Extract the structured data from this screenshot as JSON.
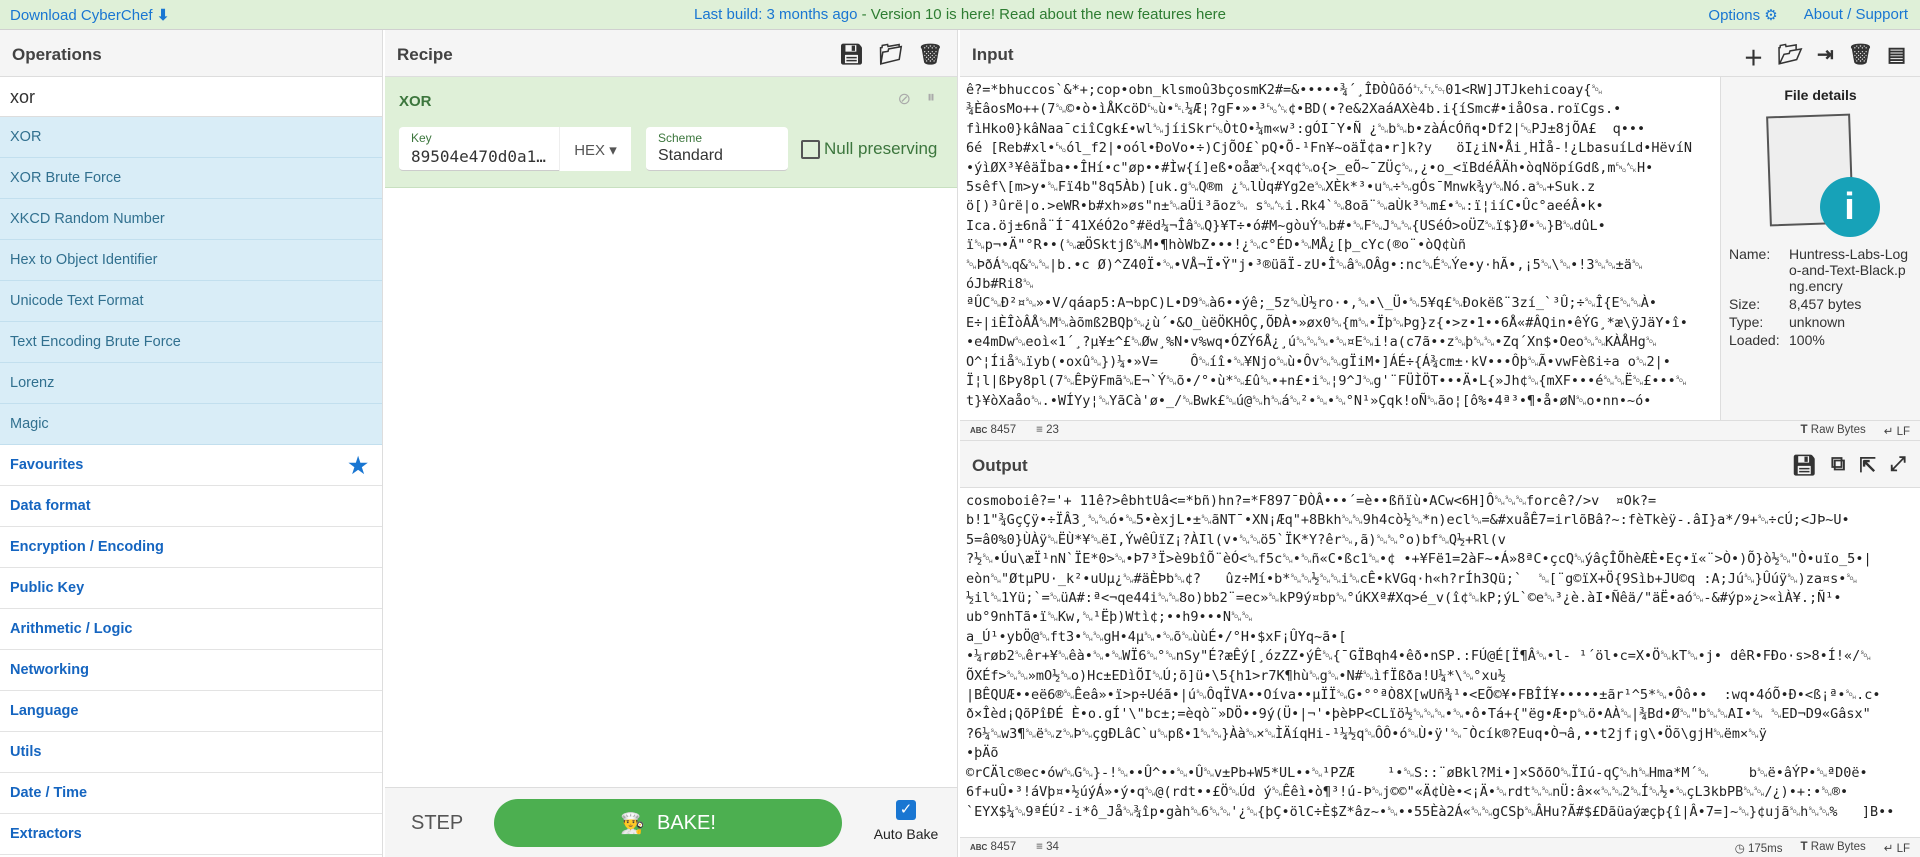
{
  "topbar": {
    "download": "Download CyberChef",
    "build_notice": "Last build: 3 months ago",
    "version_notice": " - Version 10 is here! Read about the new features here",
    "options": "Options",
    "about": "About / Support"
  },
  "operations": {
    "title": "Operations",
    "search": "xor",
    "results": [
      "XOR",
      "XOR Brute Force",
      "XKCD Random Number",
      "Hex to Object Identifier",
      "Unicode Text Format",
      "Text Encoding Brute Force",
      "Lorenz",
      "Magic"
    ],
    "categories": [
      "Favourites",
      "Data format",
      "Encryption / Encoding",
      "Public Key",
      "Arithmetic / Logic",
      "Networking",
      "Language",
      "Utils",
      "Date / Time",
      "Extractors"
    ]
  },
  "recipe": {
    "title": "Recipe",
    "op_name": "XOR",
    "key_label": "Key",
    "key_value": "89504e470d0a1…",
    "key_format": "HEX",
    "scheme_label": "Scheme",
    "scheme_value": "Standard",
    "null_preserving": "Null preserving",
    "step": "STEP",
    "bake": "BAKE!",
    "auto_bake": "Auto Bake",
    "auto_bake_checked": true
  },
  "input": {
    "title": "Input",
    "lines": [
      "ê?=*bhuccos`&*+;cop•obn_klsmoû3bçosmK2#=&•••••¾´¸ÎÐÒûõó␂␃␄01<RW]JTJkehicoay{␁",
      "¾ÈâosMo++(7␁©•ò•ìÅKcöD␅ù•␇¼Æ¦?gF•»•³␅␆¢•BD(•?e&2XaáAXè4b.i{íSmc#•iåOsa.roïCgs.•",
      "fìHko0}kâNaa¯ciîCgk£•wl␁jíiSkr␅ÒtO•¼m«w³:gÓI¯Y•Ñ ¿␁b␁b•zàÁcÓñq•Df2|␅PJ±8jÕA£  q•••",
      "6é [Reb#xl•␅ól_f2|•oól•ÐoVo•÷)CjÕO£`pQ•Õ-¹Fn¥~oäÏ¢a•r]k?y   öI¿iN•Åi¸HÌå-!¿LbasuíLd•HëvíN",
      "•ýìØX³¥êäÏba••ÎHí•c\"øp••#Ìw{í]eß•oåæ␁{×q¢␁o{>_eÕ~¯ZÜç␁,¿•o_<ïBdéÂÄh•òqNöpíGdß,m␅␆H•",
      "5sêf\\[m>y•␁Fï4b\"8q5Àb)[uk.g␁Q®m ¿␁lÙq#Yg2e␁XÈk*³•u␁÷␁gÓs¯Mnwk¾y␁Nó.a␁+Suk.z",
      "ö[)³ûrë|o.>eWR•b#xh»øs\"n±␁aÜi³ãoz␁ s␁␆i.Rk4`␁8oã¨␁aÙk³␁m£•␁:ï¦iíC•Ûc°aeéÂ•k•",
      "Ica.öj±6nå¨Í¯41XéÓ2o°#ëd¼¬Îâ␁Q}¥T÷•ó#M~gòuÝ␁b#•␁F␁J␁␁{USéÓ>oÜZ␁ï$}Ø•␁}B␁dûL•",
      "ï␁p¬•Ä\"°R••(␁æÖSktjß␁M•¶hòWbZ•••!¿␁c°ÉD•␁MÅ¿[þ_cYc(®o¨•òQ¢ùñ",
      "␁ÞðÁ␁q&␁␁|b.•c Ø)^Z40Ï•␁•VÅ¬Ï•Ÿ\"j•³®üãÏ-zU•Î␁â␁OÂg•:nc␁É␁Ýe•y·hÃ•,¡5␁\\␁•!3␁␁±ä␁",
      "óJb#Ri8␁",
      "ªÛC␁Ð²¤␁»•V/qáap5:A¬bpC)L•D9␁à6••ýê;_5z␁Ù½ro·•,␁•\\_Ü•␁5¥q£␁Ðokëß¨3zí_`³Û;÷␁Î{E␁␁À•",
      "E÷|iÈÎòÂÅ␁M␁àõmß2BQþ␁¿ù´•&O_ùëÖKHÔÇ,ÕÐÀ•»øx0␁{m␁•Ïþ␁Þg}z{•>z•1••6Å«#ÂQin•êÝG¸*æ\\ÿJäY•î•",
      "•e4mDw␁eoì«1´¸?µ¥±^£␁Øw¸%N•v%wq•ÓZÝ6Å¿¸ú␁␁␁•␁¤E␁i!a(c7ã••z␁þ␁␁•Zq´Xn$•Oeo␁␁KÀÅHg␁",
      "O^¦Íiå␁ïyb(•oxû␁})¼•»V=    Ô␁íî•␁¥Njo␁ù•Ôv␁␁gÏiM•]ÁÉ÷{Á¾cm±·kV•••Ôþ␁Ã•vwFèßi÷a o␁2|•",
      "Ï¦l|ßÞy8pl(7␁ÊÞÿFmã␁E¬`Ý␁õ•/°•ù*␁£û␁•+n£•i␁¦9^J␁g'¨FÜÌÖT•••Ä•L{»Jh¢␁{mXF•••é␁␁Ë␁£•••␁",
      "t}¥òXaåo␁.•WÍYy¦␁YãCà'ø•_/␁Bwk£␁ú@␁h␁á␁²•␁•␁°N¹»Çqk!oÑ␁ão¦[ô%•4ª³•¶•å•øN␁o•nn•~ó•"
    ],
    "length": "8457",
    "line_count": "23",
    "format": "Raw Bytes",
    "eol": "LF",
    "file": {
      "title": "File details",
      "name_label": "Name:",
      "name": "Huntress-Labs-Logo-and-Text-Black.png.encry",
      "size_label": "Size:",
      "size": "8,457 bytes",
      "type_label": "Type:",
      "type": "unknown",
      "loaded_label": "Loaded:",
      "loaded": "100%"
    }
  },
  "output": {
    "title": "Output",
    "lines": [
      "cosmoboiê?='+ 11ê?>êbhtUâ<=*bñ)hn?=*F897¯ÐÒÂ•••´=è••ßñïù•ACw<6H]Ô␁␁␁forcê?/>v  ¤Ok?=",
      "b!1\"¾GçÇÿ•÷ÏÂ3¸␁␁ó•␁5•èxjL•±␁ãNT¯•XN¡Æq\"+8Bkh␁␁9h4cò½␁*n)ecl␁=&#xuåÊ7=irlõBâ?~:fèTkèÿ-.âI}a*/9+␁÷cÚ;<JÞ~U•",
      "5=â0%0}ÙÀÿ␁ËÙ*¥␁ëI,ÝwêÛïZ¡?ÀIl(v•␁␁ö5`ÏK*Y?êr␁,ã)␁␁°o)bf␁Q½+Rl(v",
      "?½␁•Úu\\æÏ¹nN`ÏE*0>␁•Þ7³Ï>è9bîÕ¨èÓ<␁f5c␁•␁ñ«C•ßc1␁•¢ •+¥Fë1=2àF~•Á»8ªC•çcQ␁ýâçÎÕhèÆÈ•Eç•ï«¨>Ò•)Õ}ò½␁\"Ò•uïo_5•|",
      "eòn␁\"ØtµPU·_k²•uUµ¿␁#äÈÞb␁¢?   ûz÷Mí•b*␁␁½␁␁i␁cÊ•kVGq·h«h?rÍh3Qü;`  ␁[¨g©ïX+Ö{9Sìb+JU©q :A;Jú␁}Ûúÿ␁)za¤s•␁",
      "½il␁1Yü;`=␁üA#:ª<¬qe44i␁␁8o)bb2¨=ec»␁kP9ý¤bp␁°úKXª#Xq>é_v(î¢␁kP;ýL`©e␁³¿è.àI•Ñêä/\"äË•aó␁-&#ýp»¿>«ìÀ¥.;Ñ¹•",
      "ub°9nhTã•ï␁Kw,␁¹Ëþ)Wtì¢;••h9•••N␁␁",
      "a_Ú¹•ybÖ@␁ft3•␁␁gH•4µ␁•␁õ␁ùùÉ•/°H•$xF¡ÛYq~ã•[",
      "•¼røb2␁êr+¥␁êà•␁•␁WÏ6␁°␁nSy\"É?æÊý[¸ózZZ•ýÊ␁{¯GÏBqh4•êð•nSP.:FÚ@É[Ï¶Â␁•l- ¹´öl•c=X•Ö␁kT␁•j• dêR•FÐo·s>8•Í!«/␁",
      "ÕXÉf>␁␁»mO½␁o)Hc±EDìÕI␁Ú;õ]ü•\\5{h1>r7K¶hù␁g␁•N#␁ìfÏßða!U¼*\\␁°xu½",
      "|BÊQUÆ••eë6®␁Êeâ»•ï>p÷Uéã•|ú␁ÔqÏVA••Oíva••µÏÏ␁G•°°ªÒ8X[wUñ¾¹•<EÕ©¥•FBÎÍ¥•••••±ãr¹^5*␁•Ôô••  :wq•4óÕ•Ð•<ß¡ª•␁.c•",
      "ð×Îèd¡QõPîÐÉ È•o.gÍ'\\\"bc±;=èqò¨»DÖ••9ý(Ü•|¬'•þèÞP<CLïö½␁␁␁•␁•ô•Tá+{\"ëg•Æ•p␁ö•AÀ␁|¾Bd•Ø␁\"b␁␁AI•␁ ␁ED¬D9«Gâsx\"",
      "?6¼␁w3¶␁ë␁z␁Þ␁çgÐLâC`u␁pß•1␁␁}Àà␁×␁ÌÄíqHi-¹¼½q␁ÔÔ•ó␁Ù•ÿ'␁¯Òcík®?Euq•Ò¬â,••t2jf¡g\\•Öõ\\gjH␁ëm×␁ÿ",
      "•þÄõ",
      "©rCÄlc®ec•ów␁G␁}-!␁••Û^••␁•Û␁v±Pb+W5*UL••␁¹PZÆ    ¹•␁S::¨øBkl?Mi•]×SðõO␁ÏIú-qÇ␁h␁Hma*M´␁     b␁ë•âÝP•␁ªD0ë•",
      "6f+uÛ•³!áVþ¤•½úýÁ»•ý•q␁@(rdt••£Ö␁Úd ý␁Êêì•ò¶³!ú-Þ␁j©©\"«Ä¢Ùè•<¡Ä•␁rdt␁␁nÜ:â×«␁␁2␁Í␁½•␁çL3kbPB␁␁/¿)•+:•␁®•",
      "`EYX$¼␁9ªÉÚ²-i*ô_Jå␁¾îp•gàh␁6␁␁'¿␁{þÇ•ölC÷È$Z*âz~•␁••55Èà2Á«␁␁gCSþ␁ÂHu?Ã#$£Dãüaýæçþ{î|Â•7=]~␁}¢ujã␁h␁␁%   ]B••"
    ],
    "length": "8457",
    "line_count": "34",
    "time": "175ms",
    "format": "Raw Bytes",
    "eol": "LF"
  },
  "colors": {
    "topbar": "#dff0d8",
    "op_highlight": "#d9edf7",
    "recipe_op": "#dff0d8",
    "bake": "#4caf50",
    "link": "#1976d2"
  }
}
